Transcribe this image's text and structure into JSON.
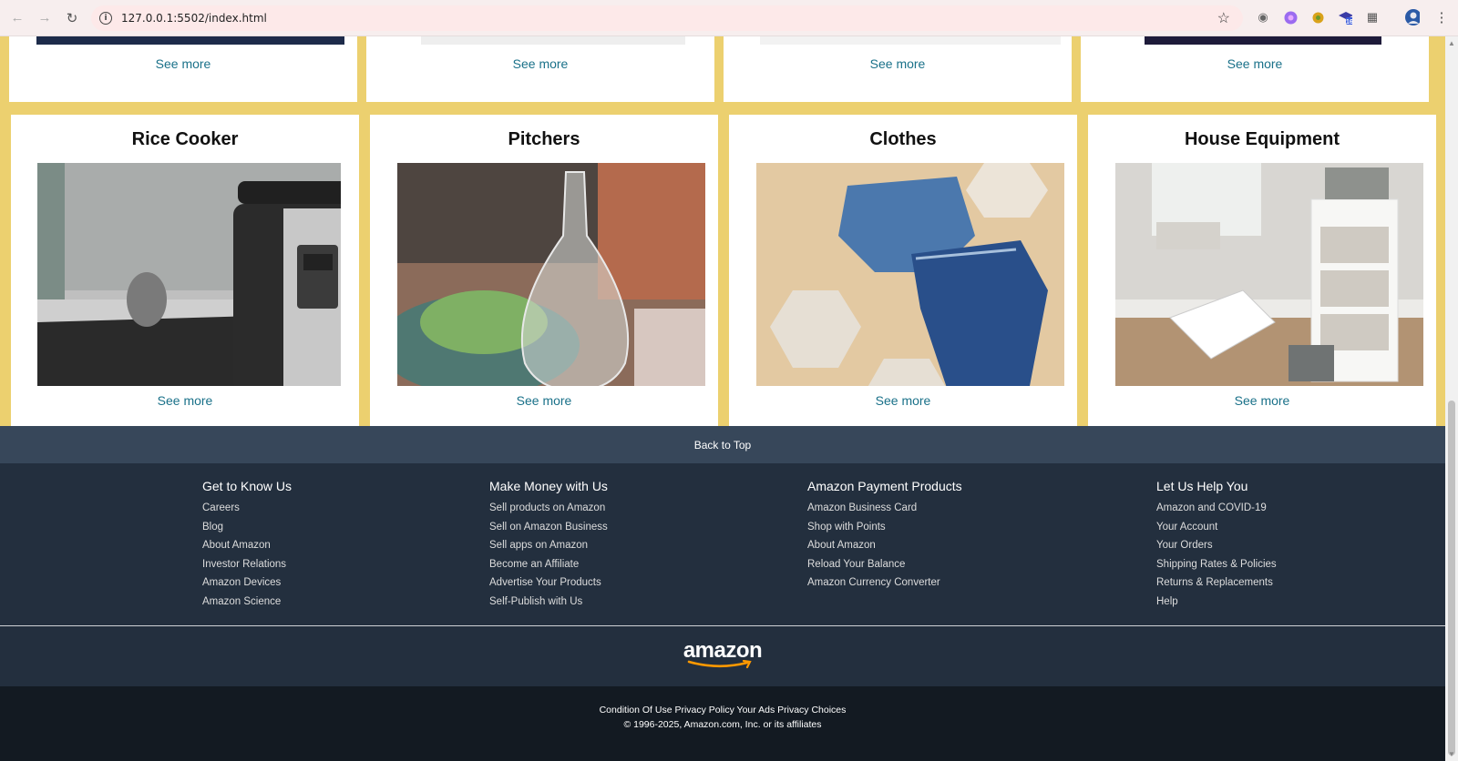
{
  "browser": {
    "url": "127.0.0.1:5502/index.html",
    "extension_badge": "16"
  },
  "top_cards": [
    {
      "see_more": "See more"
    },
    {
      "see_more": "See more"
    },
    {
      "see_more": "See more"
    },
    {
      "see_more": "See more"
    }
  ],
  "cards": [
    {
      "title": "Rice Cooker",
      "see_more": "See more"
    },
    {
      "title": "Pitchers",
      "see_more": "See more"
    },
    {
      "title": "Clothes",
      "see_more": "See more"
    },
    {
      "title": "House Equipment",
      "see_more": "See more"
    }
  ],
  "back_to_top": "Back to Top",
  "footer": {
    "columns": [
      {
        "heading": "Get to Know Us",
        "links": [
          "Careers",
          "Blog",
          "About Amazon",
          "Investor Relations",
          "Amazon Devices",
          "Amazon Science"
        ]
      },
      {
        "heading": "Make Money with Us",
        "links": [
          "Sell products on Amazon",
          "Sell on Amazon Business",
          "Sell apps on Amazon",
          "Become an Affiliate",
          "Advertise Your Products",
          "Self-Publish with Us"
        ]
      },
      {
        "heading": "Amazon Payment Products",
        "links": [
          "Amazon Business Card",
          "Shop with Points",
          "About Amazon",
          "Reload Your Balance",
          "Amazon Currency Converter"
        ]
      },
      {
        "heading": "Let Us Help You",
        "links": [
          "Amazon and COVID-19",
          "Your Account",
          "Your Orders",
          "Shipping Rates & Policies",
          "Returns & Replacements",
          "Help"
        ]
      }
    ],
    "logo_text": "amazon",
    "bottom_links": "Condition Of Use Privacy Policy Your Ads Privacy Choices",
    "copyright": "© 1996-2025, Amazon.com, Inc. or its affiliates"
  },
  "colors": {
    "page_bg": "#ecd06f",
    "link": "#1a7189",
    "footer_top": "#37475a",
    "footer_main": "#232f3e",
    "footer_bottom": "#131a22"
  }
}
